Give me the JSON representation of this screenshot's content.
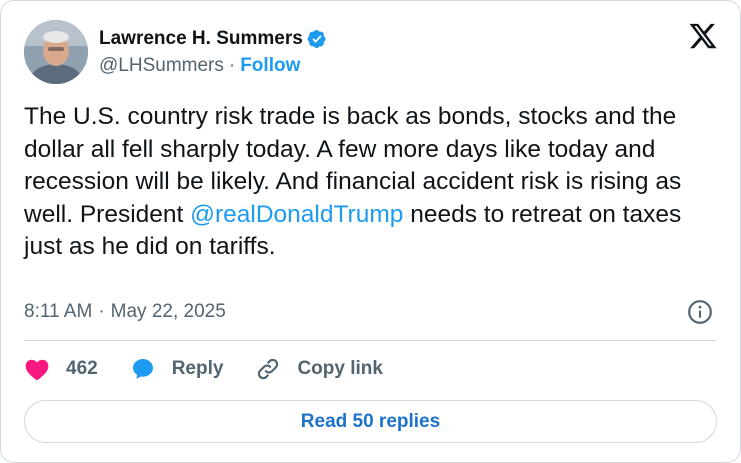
{
  "author": {
    "display_name": "Lawrence H. Summers",
    "handle": "@LHSummers",
    "separator": "·",
    "follow_label": "Follow"
  },
  "tweet": {
    "text_before": "The U.S. country risk trade is back as bonds, stocks and the dollar all fell sharply today. A few more days like today and recession will be likely. And financial accident risk is rising as well. President ",
    "mention": "@realDonaldTrump",
    "text_after": " needs to retreat on taxes just as he did on tariffs.",
    "time": "8:11 AM",
    "separator": "·",
    "date": "May 22, 2025"
  },
  "actions": {
    "like_count": "462",
    "reply_label": "Reply",
    "copy_link_label": "Copy link"
  },
  "read_replies_label": "Read 50 replies",
  "colors": {
    "accent": "#1d9bf0",
    "heart": "#f91880",
    "muted": "#536471",
    "border": "#cfd9de"
  },
  "icons": [
    "verified-badge-icon",
    "x-logo-icon",
    "info-icon",
    "heart-icon",
    "reply-bubble-icon",
    "link-icon"
  ]
}
